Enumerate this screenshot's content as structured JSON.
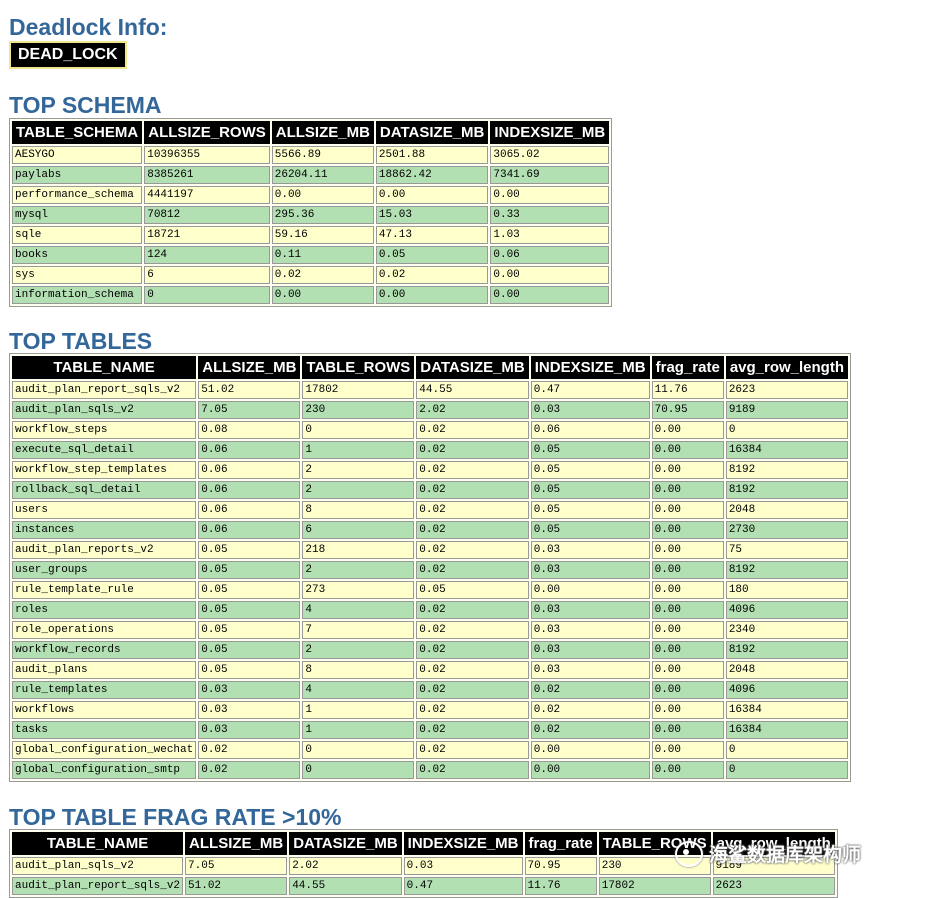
{
  "deadlock": {
    "heading": "Deadlock Info:",
    "badge": "DEAD_LOCK"
  },
  "top_schema": {
    "heading": "TOP SCHEMA",
    "columns": [
      "TABLE_SCHEMA",
      "ALLSIZE_ROWS",
      "ALLSIZE_MB",
      "DATASIZE_MB",
      "INDEXSIZE_MB"
    ],
    "rows": [
      [
        "AESYGO",
        "10396355",
        "5566.89",
        "2501.88",
        "3065.02"
      ],
      [
        "paylabs",
        "8385261",
        "26204.11",
        "18862.42",
        "7341.69"
      ],
      [
        "performance_schema",
        "4441197",
        "0.00",
        "0.00",
        "0.00"
      ],
      [
        "mysql",
        "70812",
        "295.36",
        "15.03",
        "0.33"
      ],
      [
        "sqle",
        "18721",
        "59.16",
        "47.13",
        "1.03"
      ],
      [
        "books",
        "124",
        "0.11",
        "0.05",
        "0.06"
      ],
      [
        "sys",
        "6",
        "0.02",
        "0.02",
        "0.00"
      ],
      [
        "information_schema",
        "0",
        "0.00",
        "0.00",
        "0.00"
      ]
    ]
  },
  "top_tables": {
    "heading": "TOP TABLES",
    "columns": [
      "TABLE_NAME",
      "ALLSIZE_MB",
      "TABLE_ROWS",
      "DATASIZE_MB",
      "INDEXSIZE_MB",
      "frag_rate",
      "avg_row_length"
    ],
    "rows": [
      [
        "audit_plan_report_sqls_v2",
        "51.02",
        "17802",
        "44.55",
        "0.47",
        "11.76",
        "2623"
      ],
      [
        "audit_plan_sqls_v2",
        "7.05",
        "230",
        "2.02",
        "0.03",
        "70.95",
        "9189"
      ],
      [
        "workflow_steps",
        "0.08",
        "0",
        "0.02",
        "0.06",
        "0.00",
        "0"
      ],
      [
        "execute_sql_detail",
        "0.06",
        "1",
        "0.02",
        "0.05",
        "0.00",
        "16384"
      ],
      [
        "workflow_step_templates",
        "0.06",
        "2",
        "0.02",
        "0.05",
        "0.00",
        "8192"
      ],
      [
        "rollback_sql_detail",
        "0.06",
        "2",
        "0.02",
        "0.05",
        "0.00",
        "8192"
      ],
      [
        "users",
        "0.06",
        "8",
        "0.02",
        "0.05",
        "0.00",
        "2048"
      ],
      [
        "instances",
        "0.06",
        "6",
        "0.02",
        "0.05",
        "0.00",
        "2730"
      ],
      [
        "audit_plan_reports_v2",
        "0.05",
        "218",
        "0.02",
        "0.03",
        "0.00",
        "75"
      ],
      [
        "user_groups",
        "0.05",
        "2",
        "0.02",
        "0.03",
        "0.00",
        "8192"
      ],
      [
        "rule_template_rule",
        "0.05",
        "273",
        "0.05",
        "0.00",
        "0.00",
        "180"
      ],
      [
        "roles",
        "0.05",
        "4",
        "0.02",
        "0.03",
        "0.00",
        "4096"
      ],
      [
        "role_operations",
        "0.05",
        "7",
        "0.02",
        "0.03",
        "0.00",
        "2340"
      ],
      [
        "workflow_records",
        "0.05",
        "2",
        "0.02",
        "0.03",
        "0.00",
        "8192"
      ],
      [
        "audit_plans",
        "0.05",
        "8",
        "0.02",
        "0.03",
        "0.00",
        "2048"
      ],
      [
        "rule_templates",
        "0.03",
        "4",
        "0.02",
        "0.02",
        "0.00",
        "4096"
      ],
      [
        "workflows",
        "0.03",
        "1",
        "0.02",
        "0.02",
        "0.00",
        "16384"
      ],
      [
        "tasks",
        "0.03",
        "1",
        "0.02",
        "0.02",
        "0.00",
        "16384"
      ],
      [
        "global_configuration_wechat",
        "0.02",
        "0",
        "0.02",
        "0.00",
        "0.00",
        "0"
      ],
      [
        "global_configuration_smtp",
        "0.02",
        "0",
        "0.02",
        "0.00",
        "0.00",
        "0"
      ]
    ]
  },
  "frag_rate": {
    "heading": "TOP TABLE FRAG RATE >10%",
    "columns": [
      "TABLE_NAME",
      "ALLSIZE_MB",
      "DATASIZE_MB",
      "INDEXSIZE_MB",
      "frag_rate",
      "TABLE_ROWS",
      "avg_row_length"
    ],
    "rows": [
      [
        "audit_plan_sqls_v2",
        "7.05",
        "2.02",
        "0.03",
        "70.95",
        "230",
        "9189"
      ],
      [
        "audit_plan_report_sqls_v2",
        "51.02",
        "44.55",
        "0.47",
        "11.76",
        "17802",
        "2623"
      ]
    ]
  },
  "watermark": {
    "text": "海鲨数据库架构师",
    "icon": "wechat-icon"
  },
  "colors": {
    "heading": "#336699",
    "header_bg": "#000000",
    "row_odd": "#ffffcc",
    "row_even": "#b3e0b3"
  }
}
